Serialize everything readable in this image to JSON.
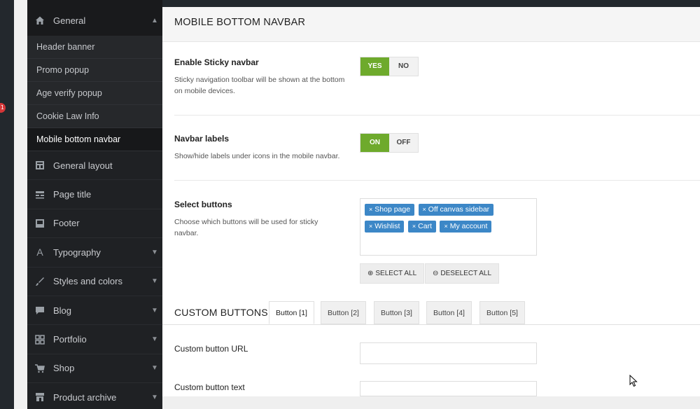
{
  "notification": {
    "count": "1"
  },
  "sidebar": {
    "general": {
      "label": "General",
      "icon": "home-icon"
    },
    "sub_items": [
      {
        "label": "Header banner"
      },
      {
        "label": "Promo popup"
      },
      {
        "label": "Age verify popup"
      },
      {
        "label": "Cookie Law Info"
      },
      {
        "label": "Mobile bottom navbar",
        "active": true
      }
    ],
    "items": [
      {
        "label": "General layout",
        "icon": "layout-icon"
      },
      {
        "label": "Page title",
        "icon": "title-icon"
      },
      {
        "label": "Footer",
        "icon": "footer-icon"
      },
      {
        "label": "Typography",
        "icon": "font-icon"
      },
      {
        "label": "Styles and colors",
        "icon": "brush-icon"
      },
      {
        "label": "Blog",
        "icon": "chat-icon"
      },
      {
        "label": "Portfolio",
        "icon": "grid-icon"
      },
      {
        "label": "Shop",
        "icon": "cart-icon"
      },
      {
        "label": "Product archive",
        "icon": "store-icon"
      }
    ]
  },
  "main": {
    "title": "MOBILE BOTTOM NAVBAR",
    "sticky": {
      "title": "Enable Sticky navbar",
      "desc": "Sticky navigation toolbar will be shown at the bottom on mobile devices.",
      "yes": "YES",
      "no": "NO"
    },
    "labels": {
      "title": "Navbar labels",
      "desc": "Show/hide labels under icons in the mobile navbar.",
      "on": "ON",
      "off": "OFF"
    },
    "select": {
      "title": "Select buttons",
      "desc": "Choose which buttons will be used for sticky navbar.",
      "tags": [
        "Shop page",
        "Off canvas sidebar",
        "Wishlist",
        "Cart",
        "My account"
      ],
      "remove_glyph": "×",
      "select_all": "SELECT ALL",
      "deselect_all": "DESELECT ALL",
      "select_all_glyph": "⊕",
      "deselect_all_glyph": "⊖"
    },
    "custom": {
      "title": "CUSTOM BUTTONS",
      "tabs": [
        "Button [1]",
        "Button [2]",
        "Button [3]",
        "Button [4]",
        "Button [5]"
      ],
      "url_label": "Custom button URL",
      "url_value": "",
      "text_label": "Custom button text",
      "text_value": ""
    }
  },
  "colors": {
    "toggle_active": "#6eaa2c",
    "tag": "#3c87c7",
    "sidebar_bg": "#1f2124"
  }
}
